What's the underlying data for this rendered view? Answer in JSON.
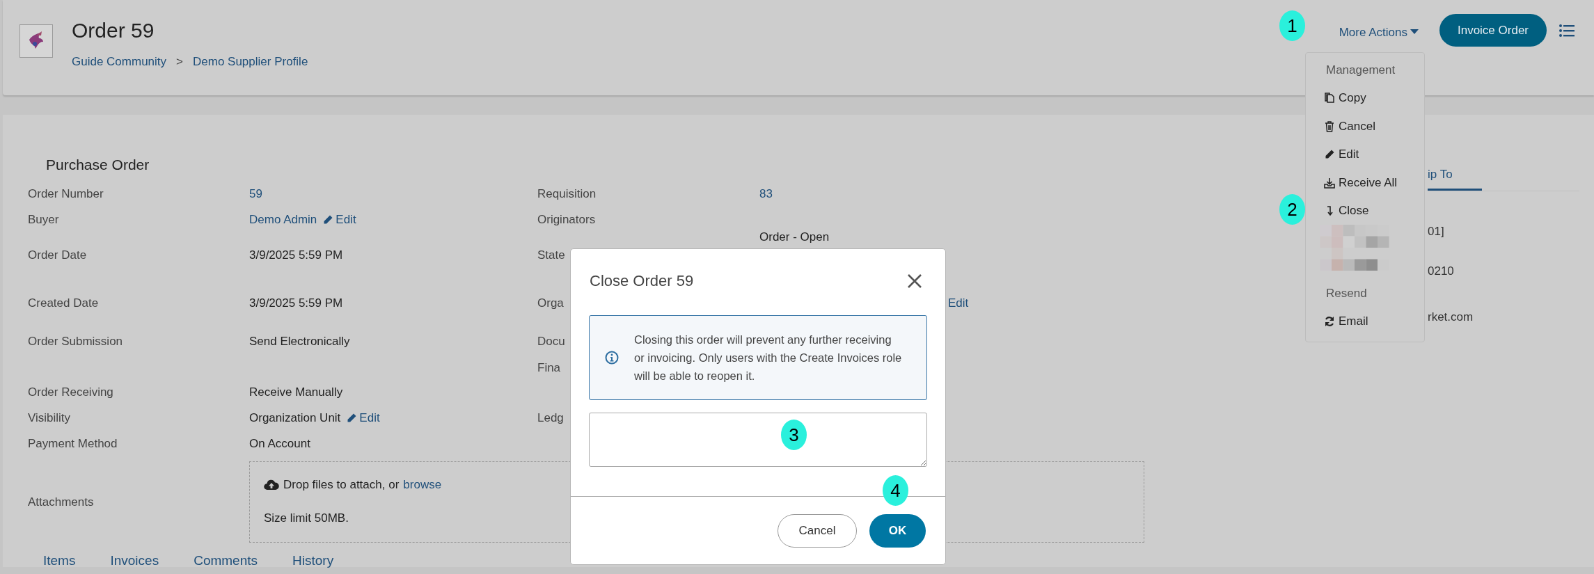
{
  "header": {
    "title": "Order 59",
    "breadcrumb": [
      "Guide Community",
      "Demo Supplier Profile"
    ],
    "separator": ">",
    "more_actions": "More Actions",
    "primary_button": "Invoice Order"
  },
  "purchase_order": {
    "title": "Purchase Order",
    "rows": [
      {
        "left": {
          "label": "Order Number",
          "value": "59",
          "kind": "link"
        },
        "right": {
          "label": "Requisition",
          "value": "83",
          "kind": "link"
        }
      },
      {
        "left": {
          "label": "Buyer",
          "value": "Demo Admin",
          "kind": "link",
          "edit": "Edit"
        },
        "right": {
          "label": "Originators"
        }
      },
      {
        "left": {
          "label": "Order Date",
          "value": "3/9/2025 5:59 PM",
          "kind": "text"
        },
        "right": {
          "label": "State",
          "value": "Order - Open",
          "kind": "text"
        }
      },
      {
        "left": {
          "label": "Created Date",
          "value": "3/9/2025 5:59 PM",
          "kind": "text"
        },
        "right": {
          "label": "Orga",
          "edit": "Edit"
        }
      },
      {
        "left": {
          "label": "Order Submission",
          "value": "Send Electronically",
          "kind": "text"
        },
        "right": {
          "label": "Docu"
        }
      },
      {
        "right": {
          "label": "Fina"
        }
      },
      {
        "left": {
          "label": "Order Receiving",
          "value": "Receive Manually",
          "kind": "text"
        }
      },
      {
        "left": {
          "label": "Visibility",
          "value": "Organization Unit",
          "kind": "text",
          "edit": "Edit"
        },
        "right": {
          "label": "Ledg"
        }
      },
      {
        "left": {
          "label": "Payment Method",
          "value": "On Account",
          "kind": "text"
        }
      }
    ],
    "attachments": {
      "label": "Attachments",
      "drop_text": "Drop files to attach, or",
      "browse": "browse",
      "limit": "Size limit 50MB."
    }
  },
  "ship_to": {
    "tab": "ip To",
    "lines": [
      "01]",
      "0210",
      "rket.com"
    ]
  },
  "bottom_tabs": [
    "Items",
    "Invoices",
    "Comments",
    "History"
  ],
  "menu": {
    "items": [
      {
        "kind": "header",
        "label": "Management"
      },
      {
        "kind": "copy",
        "label": "Copy"
      },
      {
        "kind": "delete",
        "label": "Cancel"
      },
      {
        "kind": "edit",
        "label": "Edit"
      },
      {
        "kind": "receive",
        "label": "Receive All"
      },
      {
        "kind": "close",
        "label": "Close"
      },
      {
        "kind": "redacted"
      },
      {
        "kind": "header",
        "label": "Resend"
      },
      {
        "kind": "refresh",
        "label": "Email"
      }
    ]
  },
  "dialog": {
    "title": "Close Order 59",
    "message": "Closing this order will prevent any further receiving or invoicing. Only users with the Create Invoices role will be able to reopen it.",
    "buttons": [
      {
        "label": "Cancel",
        "kind": "secondary"
      },
      {
        "label": "OK",
        "kind": "primary"
      }
    ]
  },
  "annotations": [
    "1",
    "2",
    "3",
    "4"
  ]
}
